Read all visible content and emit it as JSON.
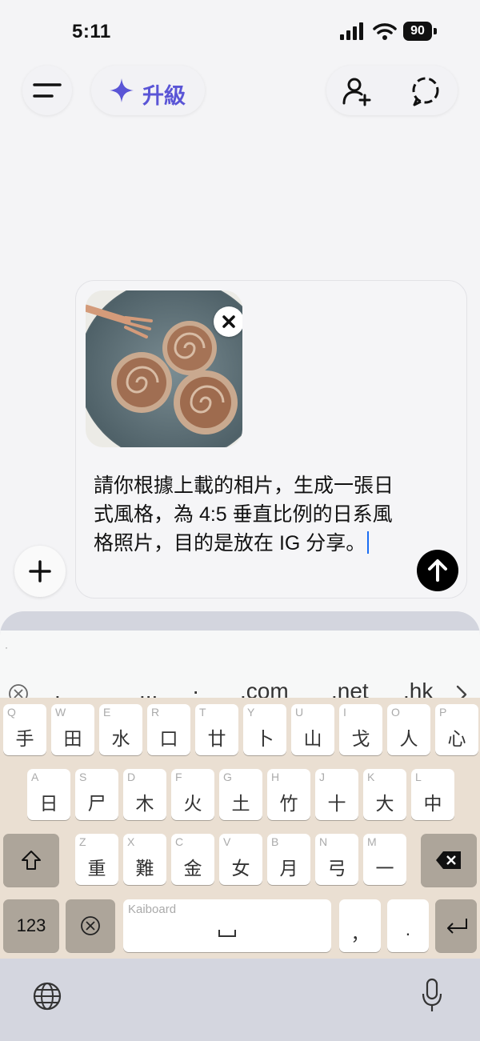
{
  "status_bar": {
    "time": "5:11",
    "battery": "90"
  },
  "header": {
    "upgrade_label": "升級"
  },
  "composer": {
    "message": "請你根據上載的相片，生成一張日式風格，為 4:5 垂直比例的日系風格照片，目的是放在 IG 分享。"
  },
  "keyboard": {
    "suggestions": [
      "。",
      "...",
      "·",
      ".com",
      ".net",
      ".hk"
    ],
    "row1": [
      {
        "hint": "Q",
        "char": "手"
      },
      {
        "hint": "W",
        "char": "田"
      },
      {
        "hint": "E",
        "char": "水"
      },
      {
        "hint": "R",
        "char": "口"
      },
      {
        "hint": "T",
        "char": "廿"
      },
      {
        "hint": "Y",
        "char": "卜"
      },
      {
        "hint": "U",
        "char": "山"
      },
      {
        "hint": "I",
        "char": "戈"
      },
      {
        "hint": "O",
        "char": "人"
      },
      {
        "hint": "P",
        "char": "心"
      }
    ],
    "row2": [
      {
        "hint": "A",
        "char": "日"
      },
      {
        "hint": "S",
        "char": "尸"
      },
      {
        "hint": "D",
        "char": "木"
      },
      {
        "hint": "F",
        "char": "火"
      },
      {
        "hint": "G",
        "char": "土"
      },
      {
        "hint": "H",
        "char": "竹"
      },
      {
        "hint": "J",
        "char": "十"
      },
      {
        "hint": "K",
        "char": "大"
      },
      {
        "hint": "L",
        "char": "中"
      }
    ],
    "row3": [
      {
        "hint": "Z",
        "char": "重"
      },
      {
        "hint": "X",
        "char": "難"
      },
      {
        "hint": "C",
        "char": "金"
      },
      {
        "hint": "V",
        "char": "女"
      },
      {
        "hint": "B",
        "char": "月"
      },
      {
        "hint": "N",
        "char": "弓"
      },
      {
        "hint": "M",
        "char": "一"
      }
    ],
    "numbers_label": "123",
    "space_label": "Kaiboard",
    "comma": "，",
    "period": "."
  }
}
